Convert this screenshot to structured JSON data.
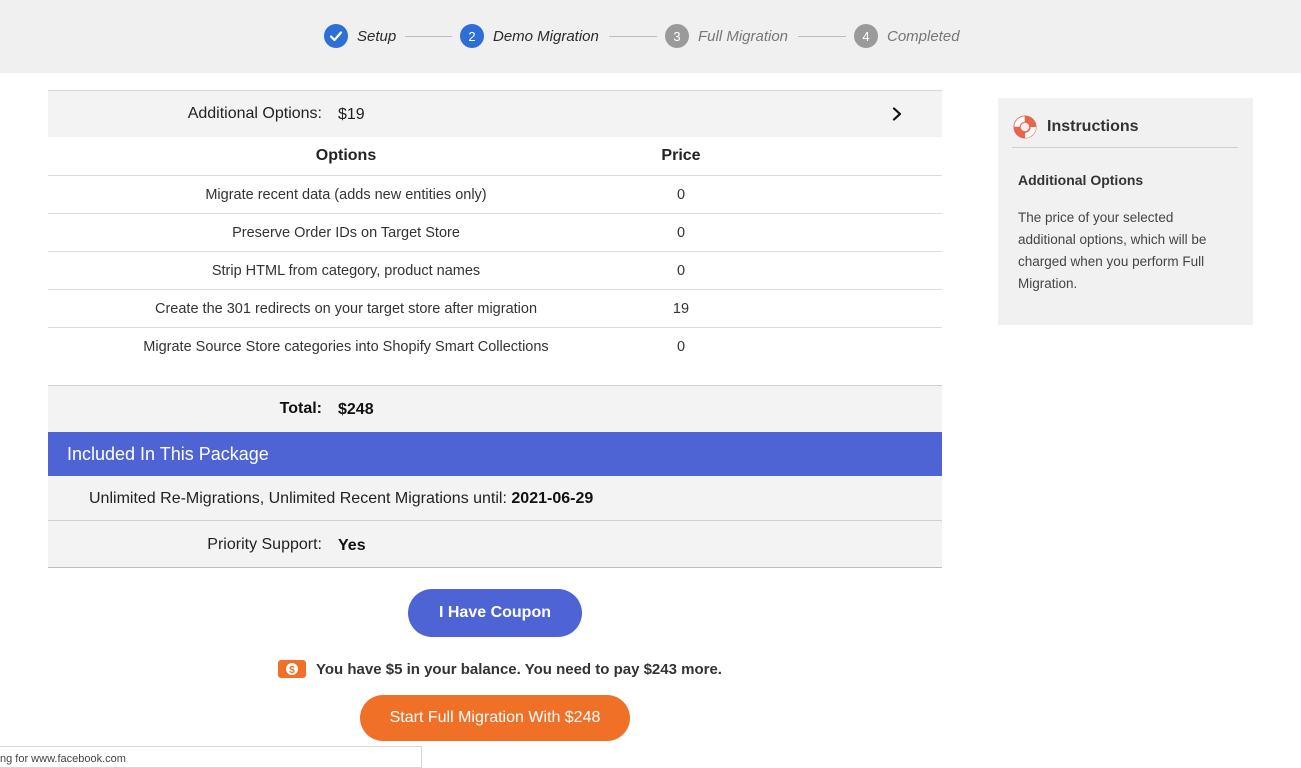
{
  "stepper": {
    "steps": [
      {
        "number": "",
        "label": "Setup",
        "state": "done",
        "icon": "check-icon"
      },
      {
        "number": "2",
        "label": "Demo Migration",
        "state": "active"
      },
      {
        "number": "3",
        "label": "Full Migration",
        "state": "inactive"
      },
      {
        "number": "4",
        "label": "Completed",
        "state": "inactive"
      }
    ]
  },
  "additional_options": {
    "label": "Additional Options:",
    "price": "$19",
    "icon": "chevron-right-icon"
  },
  "options_table": {
    "headers": [
      "Options",
      "Price"
    ],
    "rows": [
      [
        "Migrate recent data (adds new entities only)",
        "0"
      ],
      [
        "Preserve Order IDs on Target Store",
        "0"
      ],
      [
        "Strip HTML from category, product names",
        "0"
      ],
      [
        "Create the 301 redirects on your target store after migration",
        "19"
      ],
      [
        "Migrate Source Store categories into Shopify Smart Collections",
        "0"
      ]
    ]
  },
  "total": {
    "label": "Total:",
    "value": "$248"
  },
  "package": {
    "title": "Included In This Package",
    "remigrations_text": "Unlimited Re-Migrations, Unlimited Recent Migrations until:",
    "remigrations_date": "2021-06-29",
    "support_label": "Priority Support:",
    "support_value": "Yes"
  },
  "actions": {
    "coupon_label": "I Have Coupon",
    "balance_text": "You have $5 in your balance. You need to pay $243 more.",
    "balance_icon": "money-icon",
    "start_label": "Start Full Migration With $248"
  },
  "instructions": {
    "title": "Instructions",
    "icon": "lifebuoy-icon",
    "subtitle": "Additional Options",
    "body": "The price of your selected additional options, which will be charged when you perform Full Migration."
  },
  "status_bar": {
    "text": "ng for www.facebook.com"
  },
  "colors": {
    "accent_blue": "#2d6fd6",
    "package_bar": "#4f64d4",
    "start_button": "#f07028",
    "step_inactive": "#9a9a9a"
  }
}
